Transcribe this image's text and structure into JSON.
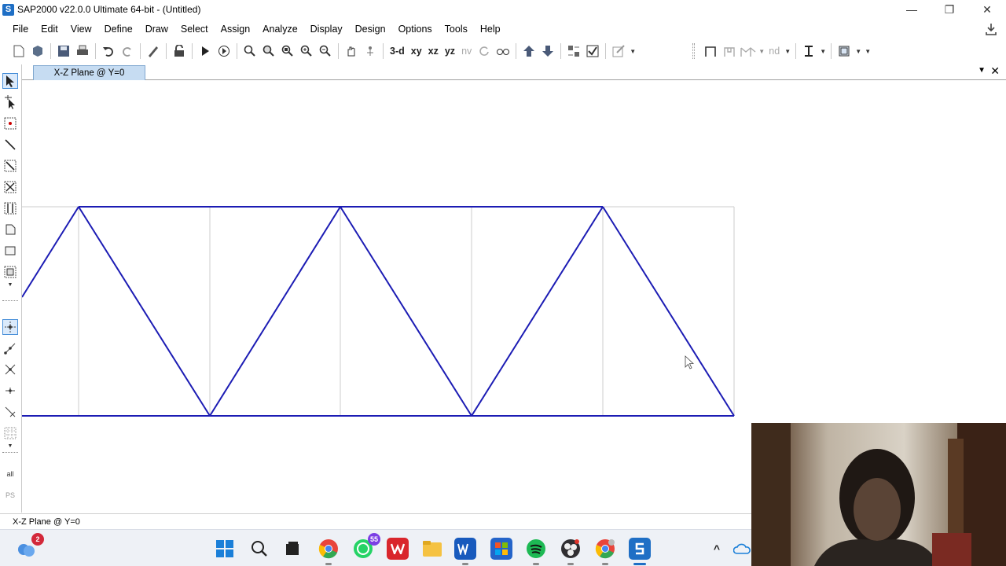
{
  "window": {
    "title": "SAP2000 v22.0.0 Ultimate 64-bit - (Untitled)",
    "app_icon_letter": "S",
    "minimize_glyph": "—",
    "maximize_glyph": "❐",
    "close_glyph": "✕"
  },
  "menu": [
    "File",
    "Edit",
    "View",
    "Define",
    "Draw",
    "Select",
    "Assign",
    "Analyze",
    "Display",
    "Design",
    "Options",
    "Tools",
    "Help"
  ],
  "toolbar": {
    "view_3d": "3-d",
    "view_xy": "xy",
    "view_xz": "xz",
    "view_yz": "yz",
    "view_nv": "nv",
    "nd_label": "nd"
  },
  "tab": {
    "label": "X-Z Plane @ Y=0",
    "menu_glyph": "▼",
    "close_glyph": "✕"
  },
  "status": {
    "text": "X-Z Plane @ Y=0"
  },
  "left_toolbar": {
    "all_label": "all",
    "ps_label": "PS"
  },
  "taskbar": {
    "weather_badge": "2",
    "whatsapp_badge": "55",
    "tray_chevron": "^"
  },
  "colors": {
    "truss_member": "#1c1cb4",
    "grid_line": "#cccccc",
    "tab_background": "#c6dcf2"
  },
  "icons": [
    "new-model-icon",
    "open-icon",
    "save-icon",
    "print-icon",
    "undo-icon",
    "redo-icon",
    "pencil-icon",
    "lock-icon",
    "run-analysis-icon",
    "zoom-icon",
    "pan-icon",
    "move-up-icon",
    "move-down-icon"
  ]
}
